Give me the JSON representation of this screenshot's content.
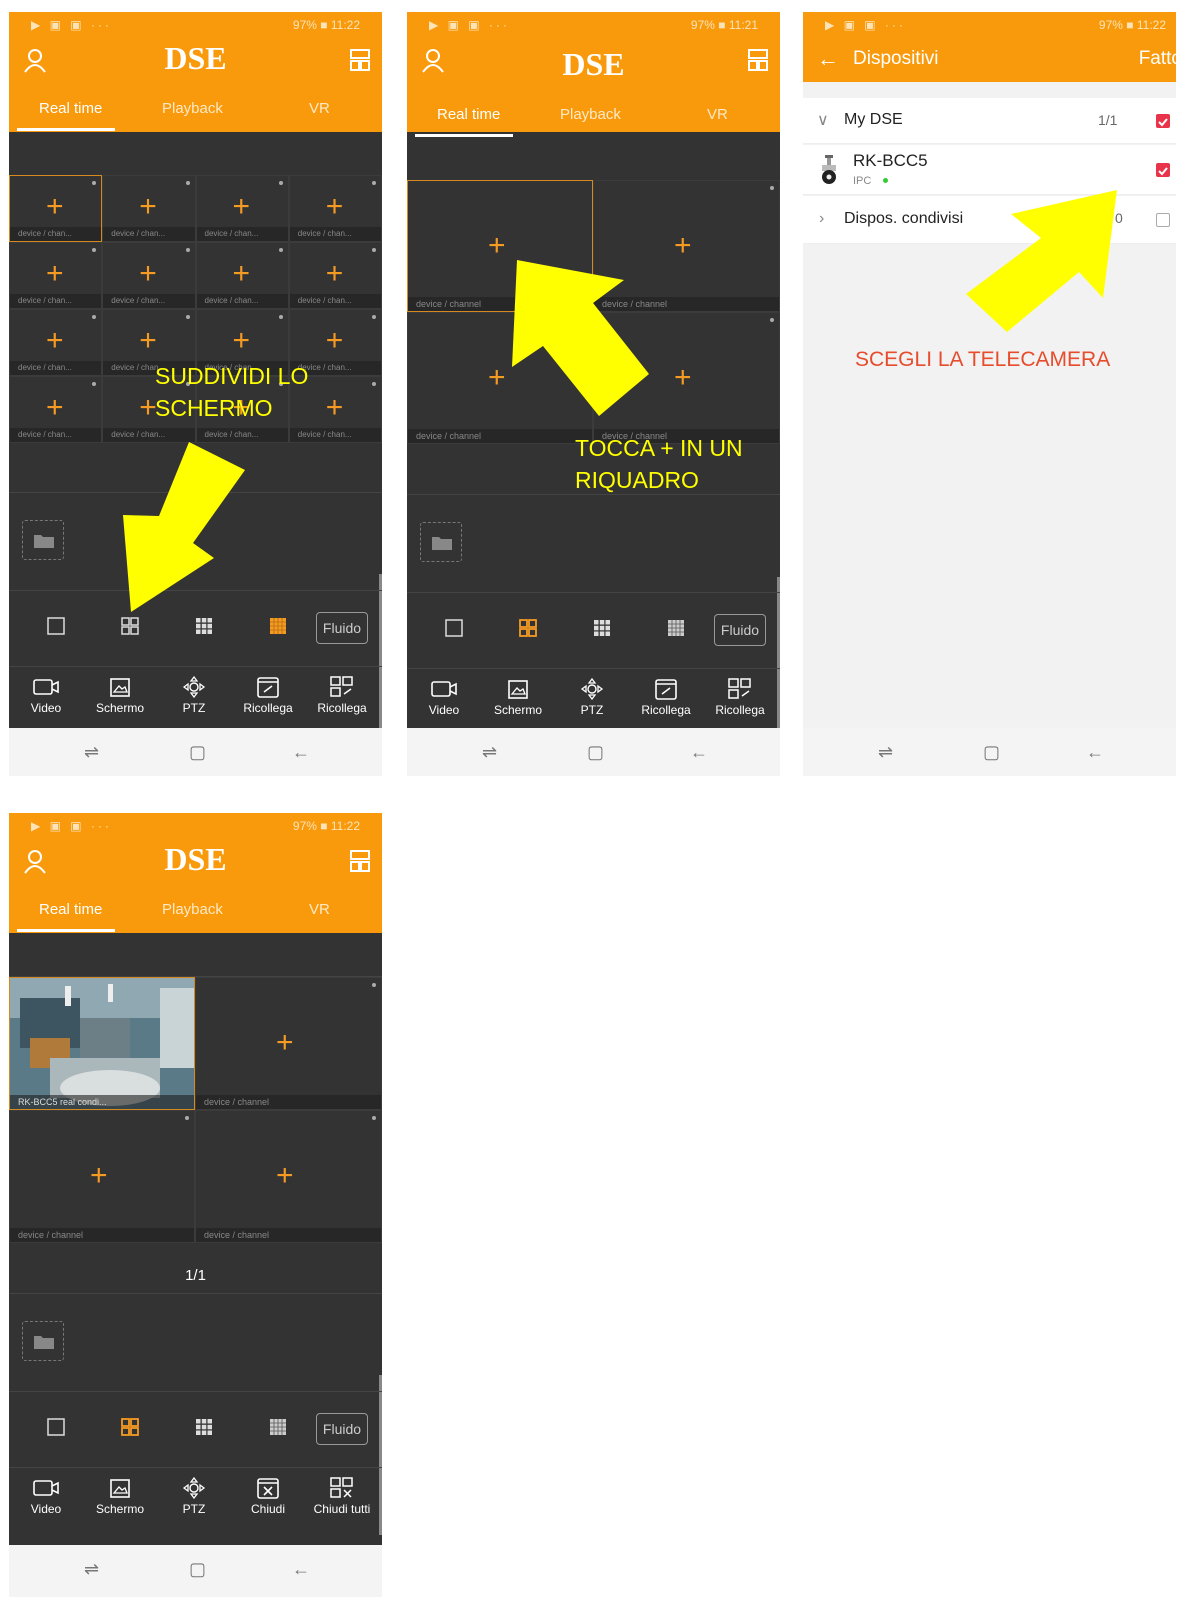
{
  "status": {
    "left": "▶ ▣ ▣ ···",
    "right_a": "97% ■ 11:22",
    "right_b": "97% ■ 11:21",
    "right_c": "97% ■ 11:22",
    "right_d": "97% ■ 11:22"
  },
  "app": {
    "logo": "DSE",
    "tabs": [
      "Real time",
      "Playback",
      "VR"
    ]
  },
  "cells": {
    "label_short": "device / chan...",
    "label": "device / channel",
    "live_label": "RK-BCC5 real condi..."
  },
  "layout_bar": {
    "fluido": "Fluido"
  },
  "tools_a": [
    "Video",
    "Schermo",
    "PTZ",
    "Ricollega",
    "Ricollega"
  ],
  "tools_b": [
    "Video",
    "Schermo",
    "PTZ",
    "Chiudi",
    "Chiudi tutti"
  ],
  "annotations": {
    "step1": [
      "SUDDIVIDI LO",
      "SCHERMO"
    ],
    "step2": [
      "TOCCA + IN UN",
      "RIQUADRO"
    ],
    "step3": "SCEGLI LA TELECAMERA"
  },
  "devices": {
    "title": "Dispositivi",
    "done": "Fatto",
    "group": "My DSE",
    "group_count": "1/1",
    "camera": "RK-BCC5",
    "camera_type": "IPC",
    "shared": "Dispos. condivisi",
    "shared_count": "0"
  },
  "page_indicator": "1/1",
  "colors": {
    "brand": "#f99a0c",
    "accent_plus": "#f59a23",
    "arrow": "#ffff00",
    "annotation_red": "#e74c2c"
  }
}
